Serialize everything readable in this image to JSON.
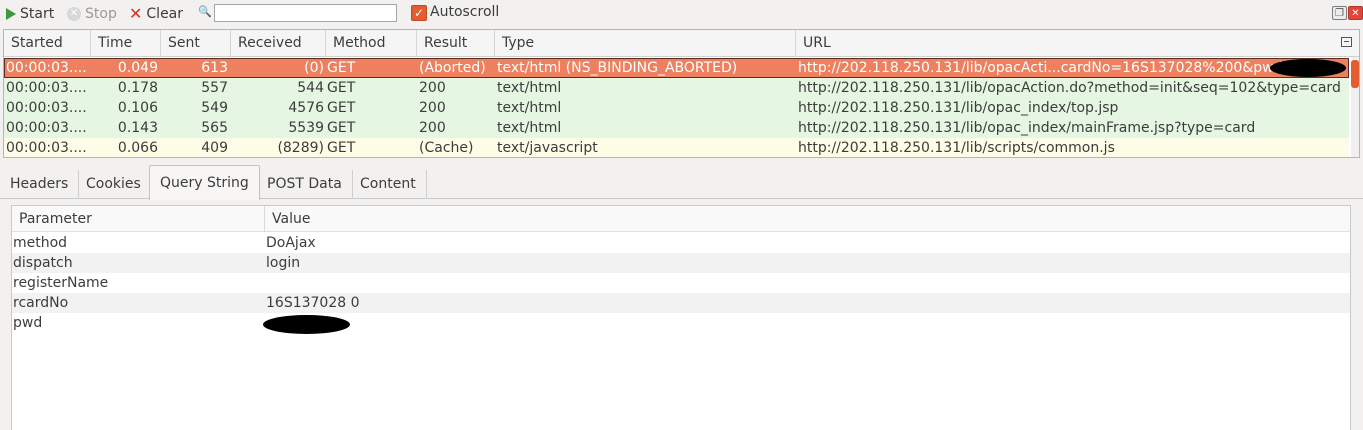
{
  "toolbar": {
    "start_label": "Start",
    "stop_label": "Stop",
    "clear_label": "Clear",
    "search_value": "",
    "autoscroll_label": "Autoscroll",
    "autoscroll_checked": true
  },
  "requests": {
    "columns": [
      "Started",
      "Time",
      "Sent",
      "Received",
      "Method",
      "Result",
      "Type",
      "URL"
    ],
    "rows": [
      {
        "started": "00:00:03....",
        "time": "0.049",
        "sent": "613",
        "received": "(0)",
        "method": "GET",
        "result": "(Aborted)",
        "type": "text/html (NS_BINDING_ABORTED)",
        "url": "http://202.118.250.131/lib/opacActi...cardNo=16S137028%200&pwd=",
        "state": "selected"
      },
      {
        "started": "00:00:03....",
        "time": "0.178",
        "sent": "557",
        "received": "544",
        "method": "GET",
        "result": "200",
        "type": "text/html",
        "url": "http://202.118.250.131/lib/opacAction.do?method=init&seq=102&type=card",
        "state": "ok"
      },
      {
        "started": "00:00:03....",
        "time": "0.106",
        "sent": "549",
        "received": "4576",
        "method": "GET",
        "result": "200",
        "type": "text/html",
        "url": "http://202.118.250.131/lib/opac_index/top.jsp",
        "state": "ok"
      },
      {
        "started": "00:00:03....",
        "time": "0.143",
        "sent": "565",
        "received": "5539",
        "method": "GET",
        "result": "200",
        "type": "text/html",
        "url": "http://202.118.250.131/lib/opac_index/mainFrame.jsp?type=card",
        "state": "ok"
      },
      {
        "started": "00:00:03....",
        "time": "0.066",
        "sent": "409",
        "received": "(8289)",
        "method": "GET",
        "result": "(Cache)",
        "type": "text/javascript",
        "url": "http://202.118.250.131/lib/scripts/common.js",
        "state": "cache"
      }
    ]
  },
  "tabs": [
    {
      "label": "Headers",
      "active": false
    },
    {
      "label": "Cookies",
      "active": false
    },
    {
      "label": "Query String",
      "active": true
    },
    {
      "label": "POST Data",
      "active": false
    },
    {
      "label": "Content",
      "active": false
    }
  ],
  "params": {
    "header_param": "Parameter",
    "header_value": "Value",
    "rows": [
      {
        "name": "method",
        "value": "DoAjax"
      },
      {
        "name": "dispatch",
        "value": "login"
      },
      {
        "name": "registerName",
        "value": ""
      },
      {
        "name": "rcardNo",
        "value": "16S137028 0"
      },
      {
        "name": "pwd",
        "value": ""
      }
    ]
  },
  "colors": {
    "selected_row": "#ee8060",
    "ok_row": "#e5f7e2",
    "cache_row": "#fdfde7",
    "accent": "#e25d2f"
  },
  "icons": {
    "start": "play-icon",
    "stop": "stop-icon",
    "clear": "clear-x-icon",
    "search": "magnifier-icon",
    "restore": "window-restore-icon",
    "close": "window-close-icon",
    "column_chooser": "column-chooser-icon"
  }
}
